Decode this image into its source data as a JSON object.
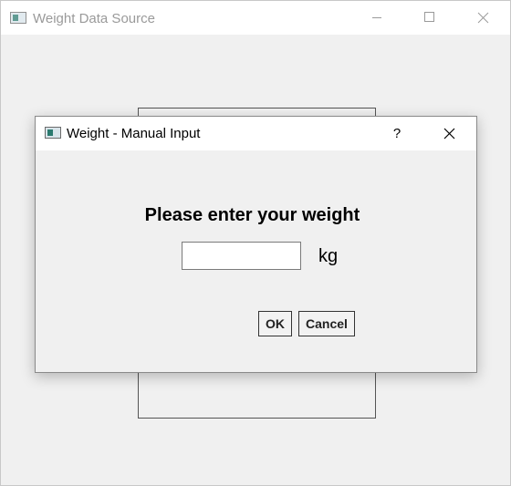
{
  "main_window": {
    "title": "Weight Data Source",
    "icon": "app-icon",
    "controls": [
      "minimize-icon",
      "maximize-icon",
      "close-icon"
    ]
  },
  "dialog": {
    "title": "Weight - Manual Input",
    "icon": "app-icon",
    "help_label": "?",
    "prompt": "Please enter your weight",
    "weight_value": "",
    "unit": "kg",
    "ok_label": "OK",
    "cancel_label": "Cancel"
  },
  "colors": {
    "window_bg": "#f0f0f0",
    "titlebar_bg": "#ffffff",
    "inactive_title_text": "#9a9a9a",
    "active_title_text": "#000000"
  }
}
